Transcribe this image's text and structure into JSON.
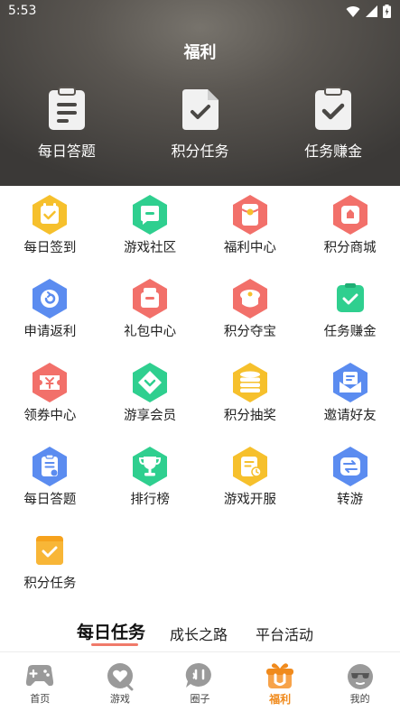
{
  "status_bar": {
    "time": "5:53",
    "icons": [
      "wifi-icon",
      "signal-icon",
      "battery-charging-icon"
    ]
  },
  "header": {
    "title": "福利"
  },
  "hero_actions": [
    {
      "label": "每日答题",
      "icon": "clipboard-list-icon"
    },
    {
      "label": "积分任务",
      "icon": "document-check-icon"
    },
    {
      "label": "任务赚金",
      "icon": "clipboard-check-icon"
    }
  ],
  "grid_items": [
    {
      "label": "每日签到",
      "icon": "calendar-check-icon",
      "color": "#f6c02c"
    },
    {
      "label": "游戏社区",
      "icon": "chat-bubble-icon",
      "color": "#2fcf8f"
    },
    {
      "label": "福利中心",
      "icon": "red-envelope-icon",
      "color": "#f2706a"
    },
    {
      "label": "积分商城",
      "icon": "shopping-bag-icon",
      "color": "#f2706a"
    },
    {
      "label": "申请返利",
      "icon": "refund-icon",
      "color": "#5b8cf0"
    },
    {
      "label": "礼包中心",
      "icon": "gift-pack-icon",
      "color": "#f2706a"
    },
    {
      "label": "积分夺宝",
      "icon": "treasure-icon",
      "color": "#f2706a"
    },
    {
      "label": "任务赚金",
      "icon": "task-check-icon",
      "color": "#2fcf8f"
    },
    {
      "label": "领券中心",
      "icon": "coupon-icon",
      "color": "#f2706a"
    },
    {
      "label": "游享会员",
      "icon": "diamond-icon",
      "color": "#2fcf8f"
    },
    {
      "label": "积分抽奖",
      "icon": "coin-stack-icon",
      "color": "#f6c02c"
    },
    {
      "label": "邀请好友",
      "icon": "invite-mail-icon",
      "color": "#5b8cf0"
    },
    {
      "label": "每日答题",
      "icon": "quiz-icon",
      "color": "#5b8cf0"
    },
    {
      "label": "排行榜",
      "icon": "trophy-icon",
      "color": "#2fcf8f"
    },
    {
      "label": "游戏开服",
      "icon": "server-open-icon",
      "color": "#f6c02c"
    },
    {
      "label": "转游",
      "icon": "transfer-icon",
      "color": "#5b8cf0"
    },
    {
      "label": "积分任务",
      "icon": "points-task-icon",
      "color": "#f6a21c"
    }
  ],
  "section_tabs": [
    {
      "label": "每日任务",
      "active": true
    },
    {
      "label": "成长之路",
      "active": false
    },
    {
      "label": "平台活动",
      "active": false
    }
  ],
  "bottom_nav": [
    {
      "label": "首页",
      "icon": "gamepad-home-icon",
      "active": false
    },
    {
      "label": "游戏",
      "icon": "heart-game-icon",
      "active": false
    },
    {
      "label": "圈子",
      "icon": "chat-circle-icon",
      "active": false
    },
    {
      "label": "福利",
      "icon": "gift-box-icon",
      "active": true
    },
    {
      "label": "我的",
      "icon": "sunglasses-face-icon",
      "active": false
    }
  ],
  "colors": {
    "accent": "#f08a1c",
    "tab_underline": "#f07a6a",
    "yellow": "#f6c02c",
    "green": "#2fcf8f",
    "red": "#f2706a",
    "blue": "#5b8cf0"
  }
}
